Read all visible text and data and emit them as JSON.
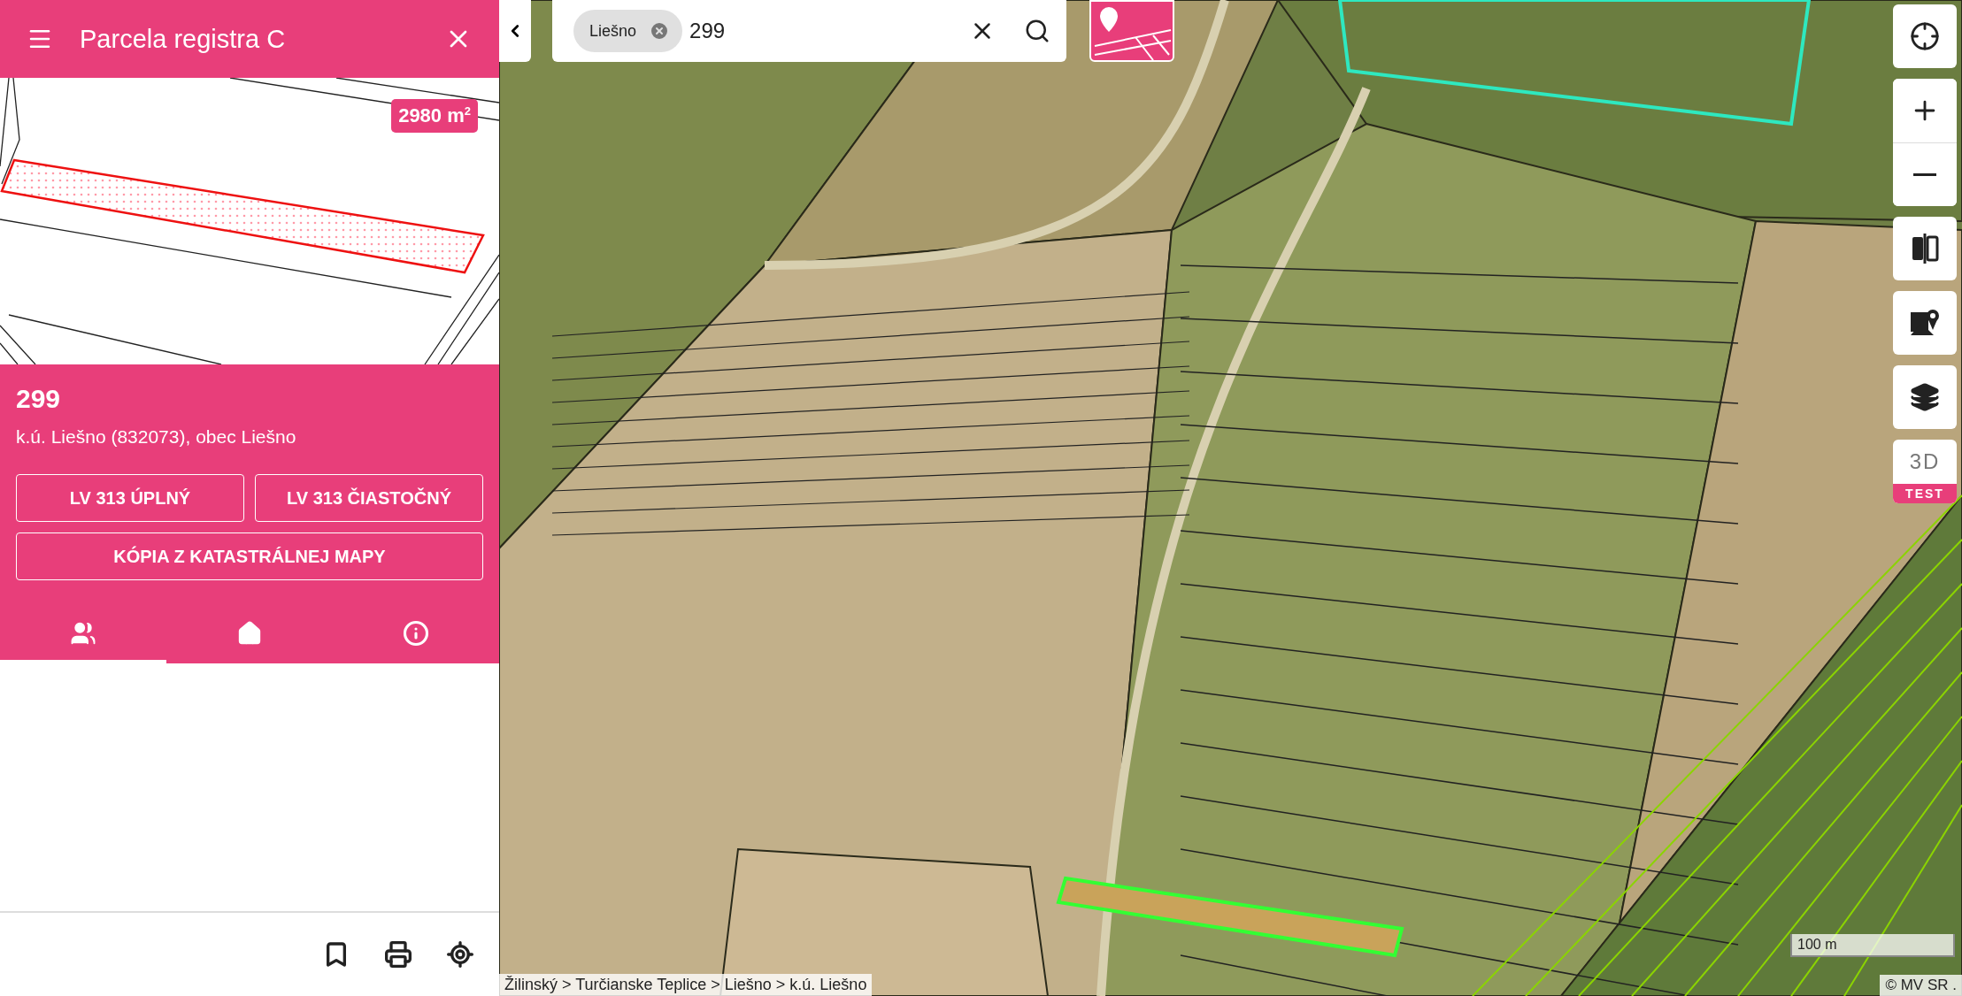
{
  "panel": {
    "title": "Parcela registra C",
    "area_badge": "2980 m$^{2}$",
    "parcel_number": "299",
    "location": "k.ú. Liešno (832073), obec Liešno",
    "buttons": [
      "LV 313 ÚPLNÝ",
      "LV 313 ČIASTOČNÝ",
      "KÓPIA Z KATASTRÁLNEJ MAPY"
    ],
    "tabs": [
      {
        "kind": "owners",
        "selected": true
      },
      {
        "kind": "home",
        "selected": false
      },
      {
        "kind": "info",
        "selected": false
      }
    ]
  },
  "search": {
    "chip": "Liešno",
    "value": "299"
  },
  "map_controls": {
    "three_d": "3D",
    "test_badge": "TEST"
  },
  "breadcrumb": "Žilinský > Turčianske Teplice > Liešno > k.ú. Liešno",
  "scale": "100 m",
  "attribution": "© MV SR ."
}
